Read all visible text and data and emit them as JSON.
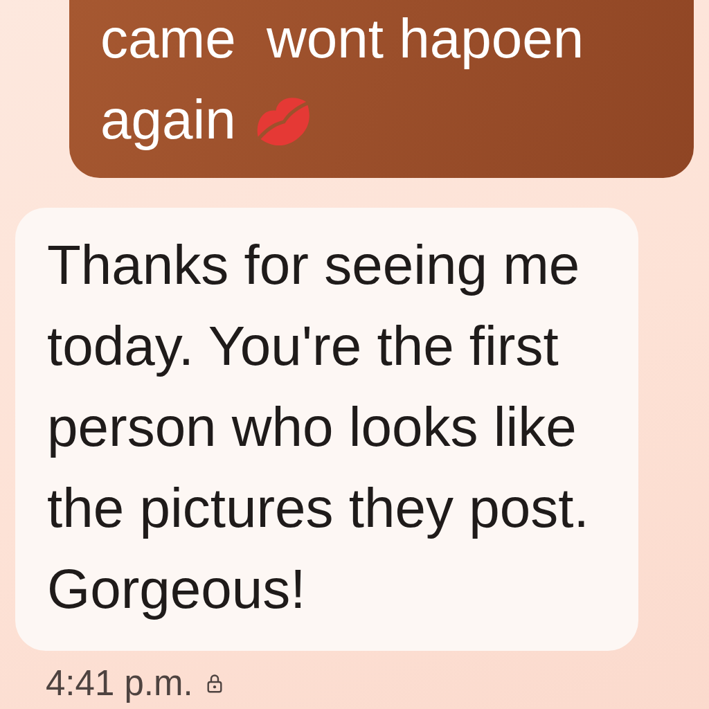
{
  "messages": [
    {
      "kind": "sent",
      "lines": [
        "came  wont hapoen",
        "again"
      ]
    },
    {
      "kind": "received",
      "lines": [
        "Thanks for seeing me today. You're the first person who looks like the pictures they post. Gorgeous!"
      ]
    }
  ],
  "timestamp": {
    "text": "4:41 p.m.",
    "encrypted": true
  }
}
